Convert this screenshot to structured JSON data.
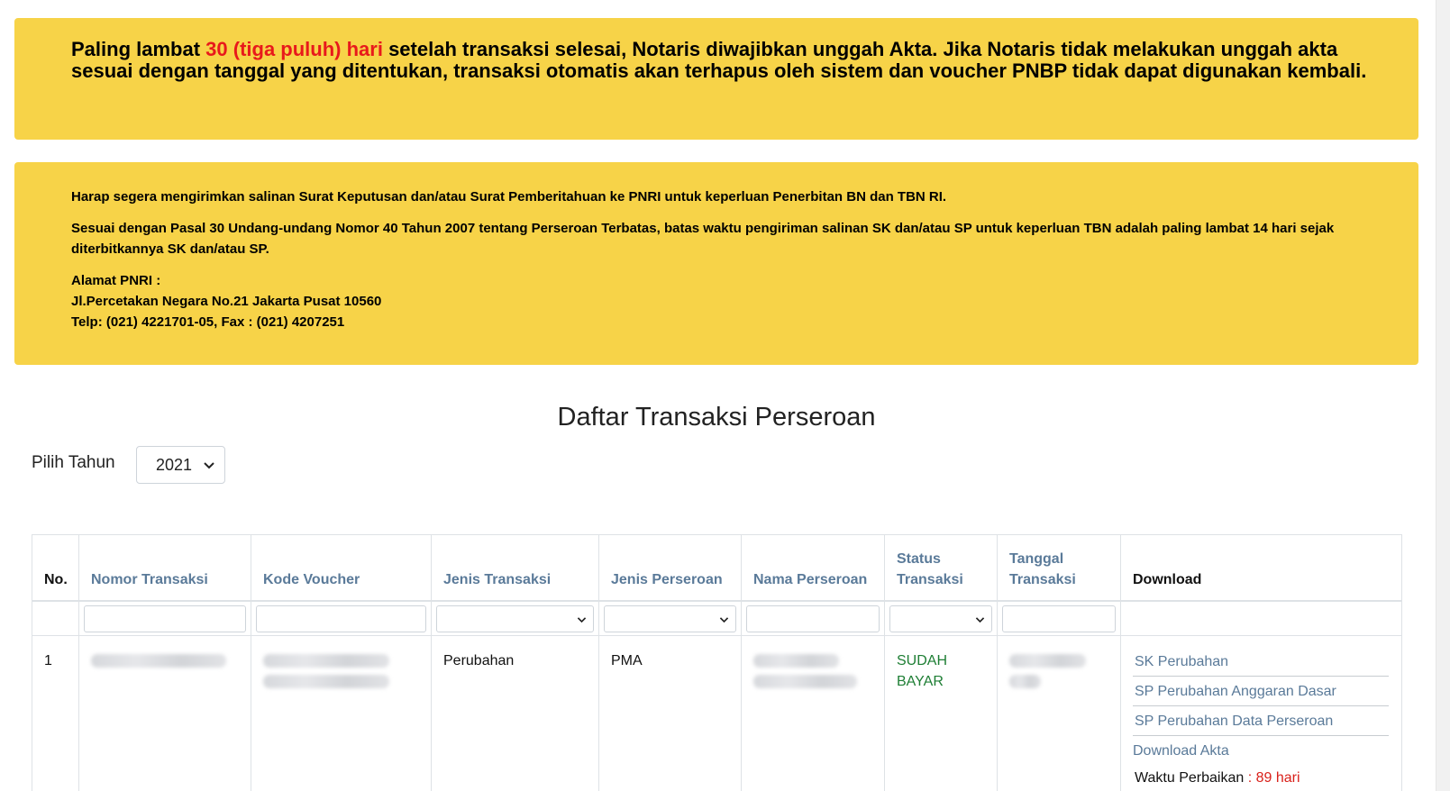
{
  "alert_top": {
    "part1": "Paling lambat ",
    "highlight": "30 (tiga puluh) hari",
    "part2": " setelah transaksi selesai, Notaris diwajibkan unggah Akta. Jika Notaris tidak melakukan unggah akta sesuai dengan tanggal yang ditentukan, transaksi otomatis akan terhapus oleh sistem dan voucher PNBP tidak dapat digunakan kembali."
  },
  "alert_info": {
    "p1": "Harap segera mengirimkan salinan Surat Keputusan dan/atau Surat Pemberitahuan ke PNRI untuk keperluan Penerbitan BN dan TBN RI.",
    "p2": "Sesuai dengan Pasal 30 Undang-undang Nomor 40 Tahun 2007 tentang Perseroan Terbatas, batas waktu pengiriman salinan SK dan/atau SP untuk keperluan TBN adalah paling lambat 14 hari sejak diterbitkannya SK dan/atau SP.",
    "address_title": "Alamat PNRI :",
    "address_line": "Jl.Percetakan Negara No.21 Jakarta Pusat 10560",
    "phone_line": "Telp: (021) 4221701-05, Fax : (021) 4207251"
  },
  "title": "Daftar Transaksi Perseroan",
  "year_filter": {
    "label": "Pilih Tahun",
    "selected": "2021"
  },
  "table": {
    "headers": {
      "no": "No.",
      "nomor_transaksi": "Nomor Transaksi",
      "kode_voucher": "Kode Voucher",
      "jenis_transaksi": "Jenis Transaksi",
      "jenis_perseroan": "Jenis Perseroan",
      "nama_perseroan": "Nama Perseroan",
      "status_transaksi": "Status Transaksi",
      "tanggal_transaksi": "Tanggal Transaksi",
      "download": "Download"
    },
    "row1": {
      "no": "1",
      "jenis_transaksi": "Perubahan",
      "jenis_perseroan": "PMA",
      "status_line1": "SUDAH",
      "status_line2": "BAYAR",
      "downloads": [
        "SK Perubahan",
        "SP Perubahan Anggaran Dasar",
        "SP Perubahan Data Perseroan",
        "Download Akta"
      ],
      "fix_label": "Waktu Perbaikan",
      "fix_sep": " : ",
      "fix_value": "89 hari"
    }
  },
  "icons": {
    "select_chevron": "chevron-down-icon"
  }
}
